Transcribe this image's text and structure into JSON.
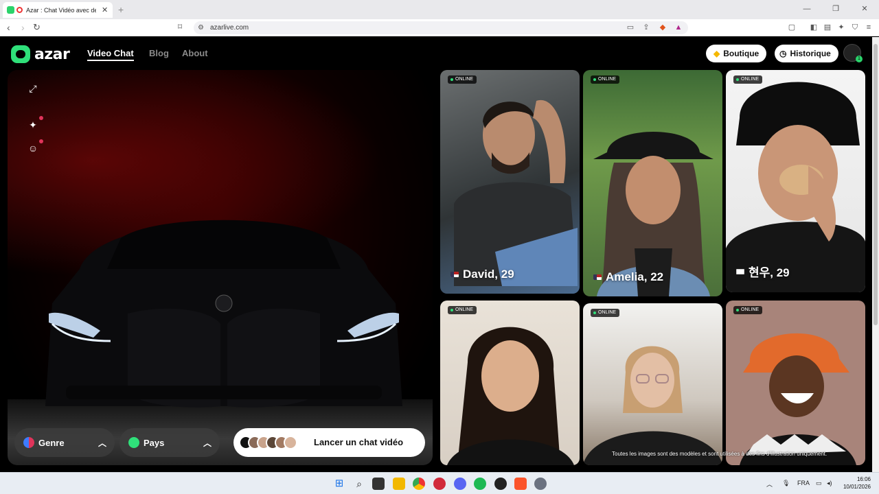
{
  "browser": {
    "tab_title": "Azar : Chat Vidéo avec de no",
    "url": "azarlive.com",
    "new_tab": "+",
    "close": "✕"
  },
  "site": {
    "logo_text": "azar",
    "nav": [
      {
        "label": "Video Chat",
        "active": true
      },
      {
        "label": "Blog",
        "active": false
      },
      {
        "label": "About",
        "active": false
      }
    ],
    "boutique_label": "Boutique",
    "historique_label": "Historique",
    "avatar_badge": "1"
  },
  "video_panel": {
    "genre_label": "Genre",
    "pays_label": "Pays",
    "start_label": "Lancer un chat vidéo"
  },
  "profiles": [
    {
      "status": "ONLINE",
      "name": "David, 29",
      "flag": "us"
    },
    {
      "status": "ONLINE",
      "name": "Amelia, 22",
      "flag": "us"
    },
    {
      "status": "ONLINE",
      "name": "현우, 29",
      "flag": "kr"
    },
    {
      "status": "ONLINE",
      "name": "",
      "flag": ""
    },
    {
      "status": "ONLINE",
      "name": "",
      "flag": ""
    },
    {
      "status": "ONLINE",
      "name": "",
      "flag": ""
    }
  ],
  "disclaimer": "Toutes les images sont des modèles et sont utilisées à des fins d'illustration uniquement.",
  "taskbar": {
    "language": "FRA",
    "time": "16:06",
    "date": "10/01/2026"
  },
  "colors": {
    "brand_green": "#2fe07a",
    "background": "#000000",
    "notification_pink": "#e0345a"
  }
}
